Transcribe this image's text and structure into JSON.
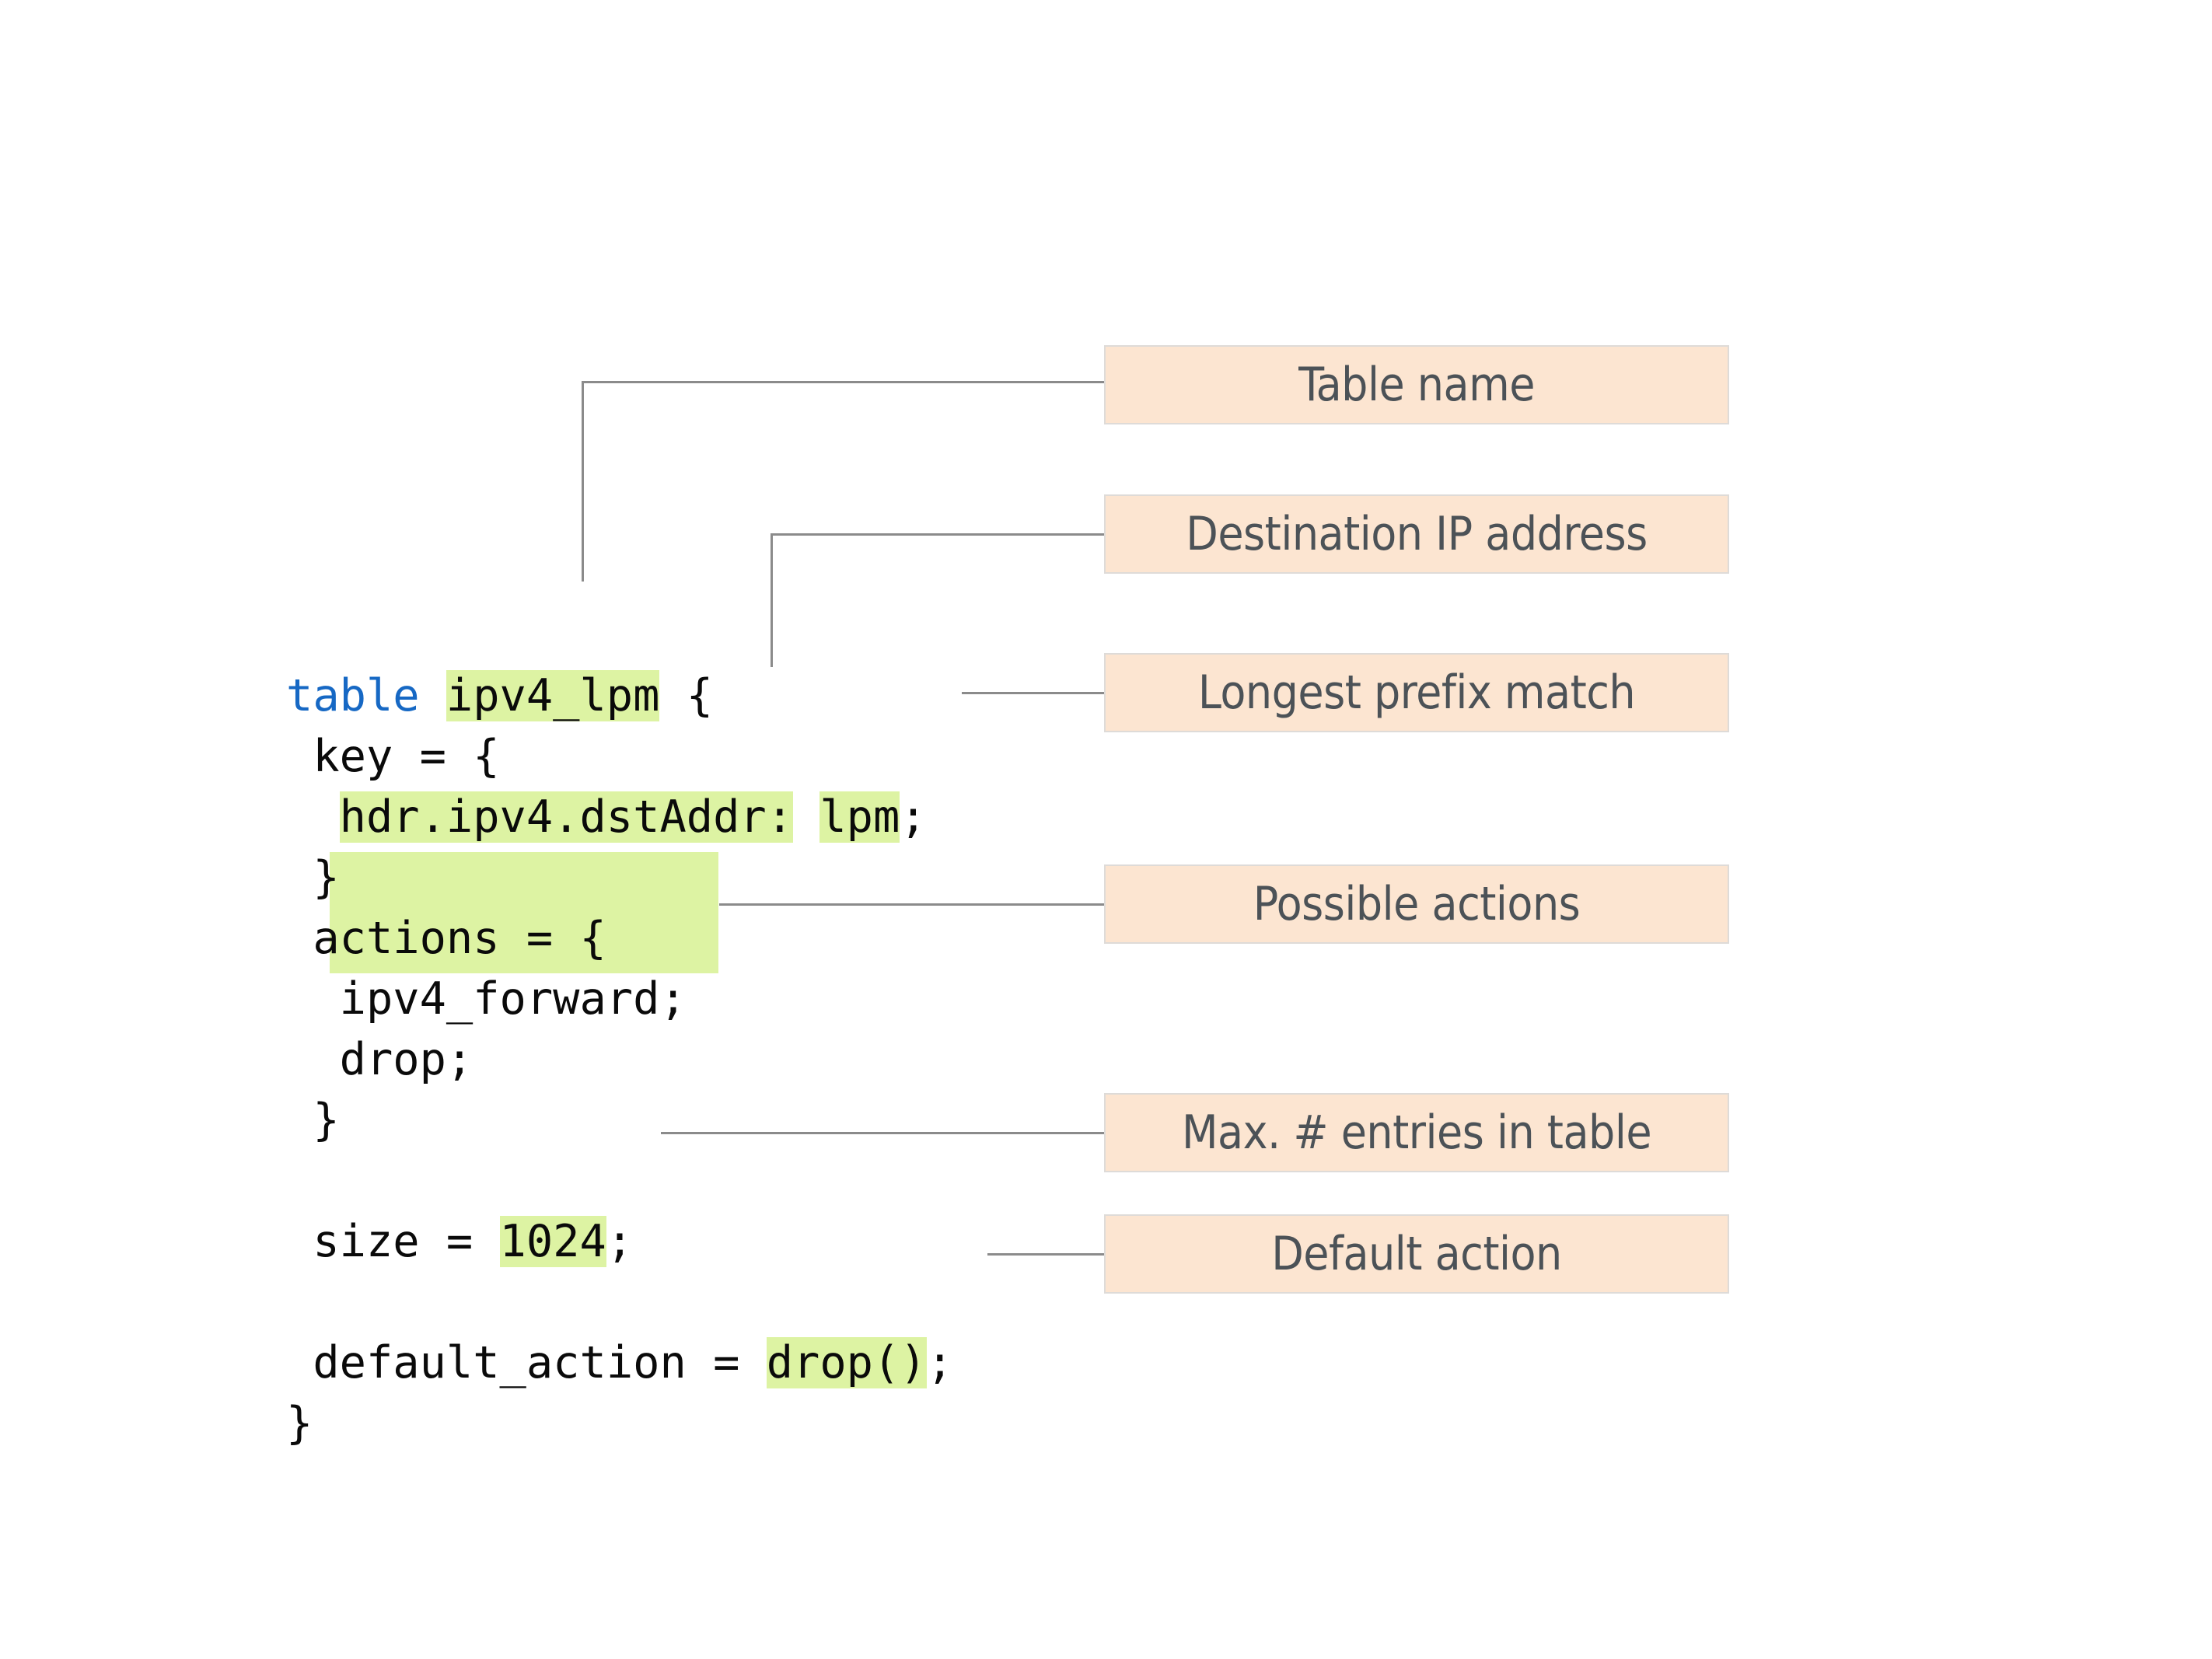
{
  "code": {
    "language": "p4",
    "lines": [
      {
        "id": "line-table",
        "indent": 0,
        "segments": [
          {
            "text": "table ",
            "style": "keyword"
          },
          {
            "text": "ipv4_lpm",
            "style": "highlight"
          },
          {
            "text": " {",
            "style": "plain"
          }
        ]
      },
      {
        "id": "line-key-open",
        "indent": 1,
        "segments": [
          {
            "text": "key = {",
            "style": "plain"
          }
        ]
      },
      {
        "id": "line-key-entry",
        "indent": 2,
        "segments": [
          {
            "text": "hdr.ipv4.dstAddr:",
            "style": "highlight"
          },
          {
            "text": " ",
            "style": "plain"
          },
          {
            "text": "lpm",
            "style": "highlight"
          },
          {
            "text": ";",
            "style": "plain"
          }
        ]
      },
      {
        "id": "line-key-close",
        "indent": 1,
        "segments": [
          {
            "text": "}",
            "style": "plain"
          }
        ]
      },
      {
        "id": "line-actions-open",
        "indent": 1,
        "segments": [
          {
            "text": "actions = {",
            "style": "plain"
          }
        ]
      },
      {
        "id": "line-action-forward",
        "indent": 2,
        "segments": [
          {
            "text": "ipv4_forward;",
            "style": "plain"
          }
        ]
      },
      {
        "id": "line-action-drop",
        "indent": 2,
        "segments": [
          {
            "text": "drop;",
            "style": "plain"
          }
        ]
      },
      {
        "id": "line-actions-close",
        "indent": 1,
        "segments": [
          {
            "text": "}",
            "style": "plain"
          }
        ]
      },
      {
        "id": "line-blank-1",
        "indent": 0,
        "segments": [
          {
            "text": " ",
            "style": "plain"
          }
        ]
      },
      {
        "id": "line-size",
        "indent": 1,
        "segments": [
          {
            "text": "size = ",
            "style": "plain"
          },
          {
            "text": "1024",
            "style": "highlight"
          },
          {
            "text": ";",
            "style": "plain"
          }
        ]
      },
      {
        "id": "line-blank-2",
        "indent": 0,
        "segments": [
          {
            "text": " ",
            "style": "plain"
          }
        ]
      },
      {
        "id": "line-default-action",
        "indent": 1,
        "segments": [
          {
            "text": "default_action = ",
            "style": "plain"
          },
          {
            "text": "drop()",
            "style": "highlight"
          },
          {
            "text": ";",
            "style": "plain"
          }
        ]
      },
      {
        "id": "line-table-close",
        "indent": 0,
        "segments": [
          {
            "text": "}",
            "style": "plain"
          }
        ]
      }
    ],
    "raw_text": "table ipv4_lpm {\n key = {\n  hdr.ipv4.dstAddr: lpm;\n }\n actions = {\n  ipv4_forward;\n  drop;\n }\n\n size = 1024;\n\n default_action = drop();\n}"
  },
  "annotations": [
    {
      "id": "annot-table-name",
      "label": "Table name",
      "target": "ipv4_lpm"
    },
    {
      "id": "annot-dest-ip",
      "label": "Destination IP address",
      "target": "hdr.ipv4.dstAddr"
    },
    {
      "id": "annot-lpm",
      "label": "Longest prefix match",
      "target": "lpm"
    },
    {
      "id": "annot-actions",
      "label": "Possible actions",
      "target": "ipv4_forward; drop;"
    },
    {
      "id": "annot-size",
      "label": "Max. # entries in table",
      "target": "1024"
    },
    {
      "id": "annot-default-action",
      "label": "Default action",
      "target": "drop()"
    }
  ],
  "colors": {
    "highlight_green": "#ddf3a3",
    "annotation_peach": "#fce5d1",
    "annotation_border": "#dedbd8",
    "annotation_text": "#4c5257",
    "keyword_blue": "#1668c4",
    "code_text": "#0a0a0a",
    "connector_line": "#8b8b8b",
    "background": "#ffffff"
  }
}
